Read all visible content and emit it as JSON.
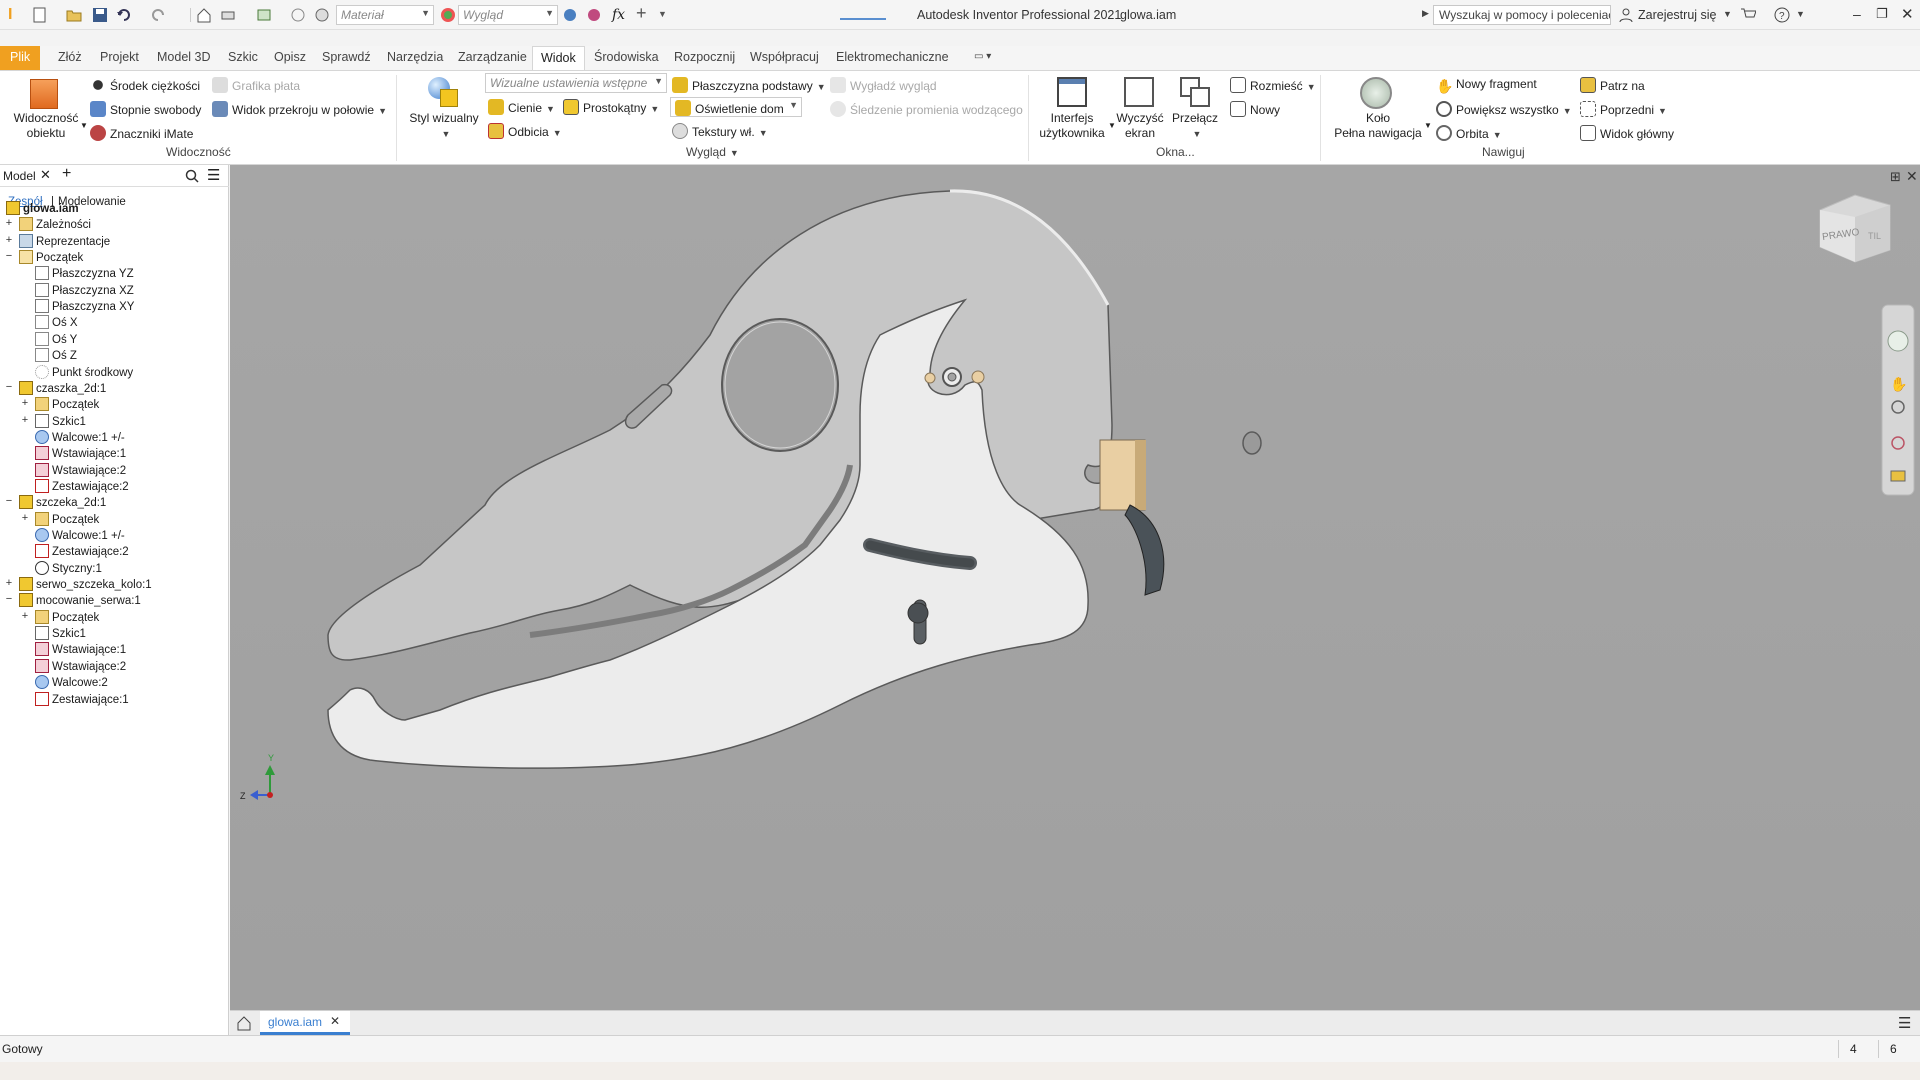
{
  "app": {
    "title": "Autodesk Inventor Professional 2021",
    "document": "glowa.iam"
  },
  "quick_access": {
    "material_placeholder": "Materiał",
    "appearance_placeholder": "Wygląd",
    "fx_label": "fx"
  },
  "search": {
    "placeholder": "Wyszukaj w pomocy i poleceniach"
  },
  "account": {
    "sign_in": "Zarejestruj się"
  },
  "menu": {
    "file": "Plik",
    "tabs": [
      "Złóż",
      "Projekt",
      "Model 3D",
      "Szkic",
      "Opisz",
      "Sprawdź",
      "Narzędzia",
      "Zarządzanie",
      "Widok",
      "Środowiska",
      "Rozpocznij",
      "Współpracuj",
      "Elektromechaniczne"
    ],
    "active": "Widok"
  },
  "ribbon": {
    "visibility": {
      "big_label_1": "Widoczność",
      "big_label_2": "obiektu",
      "center_of_gravity": "Środek ciężkości",
      "dof": "Stopnie swobody",
      "imate": "Znaczniki iMate",
      "plate_graphics": "Grafika płata",
      "half_section": "Widok przekroju w połowie",
      "group": "Widoczność"
    },
    "appearance": {
      "visual_style_1": "Styl wizualny",
      "preset_placeholder": "Wizualne ustawienia wstępne",
      "shadows": "Cienie",
      "reflections": "Odbicia",
      "orthographic": "Prostokątny",
      "ground_plane": "Płaszczyzna podstawy",
      "lighting": "Oświetlenie dom",
      "textures": "Tekstury wł.",
      "smooth_appearance": "Wygładź wygląd",
      "ray_tracing": "Śledzenie promienia wodzącego",
      "group": "Wygląd"
    },
    "windows": {
      "ui_1": "Interfejs",
      "ui_2": "użytkownika",
      "clear_1": "Wyczyść",
      "clear_2": "ekran",
      "switch": "Przełącz",
      "arrange": "Rozmieść",
      "new": "Nowy",
      "group": "Okna..."
    },
    "navigate": {
      "wheel_1": "Koło",
      "wheel_2": "Pełna nawigacja",
      "new_fragment": "Nowy fragment",
      "zoom_all": "Powiększ wszystko",
      "orbit": "Orbita",
      "look_at": "Patrz na",
      "previous": "Poprzedni",
      "home_view": "Widok główny",
      "group": "Nawiguj"
    }
  },
  "browser": {
    "tab": "Model",
    "subtab_1": "Zespół",
    "subtab_2": "Modelowanie",
    "tree": [
      {
        "label": "glowa.iam",
        "level": 0,
        "exp": "",
        "icon": "assembly"
      },
      {
        "label": "Zależności",
        "level": 1,
        "exp": "+",
        "icon": "folder"
      },
      {
        "label": "Reprezentacje",
        "level": 1,
        "exp": "+",
        "icon": "repr"
      },
      {
        "label": "Początek",
        "level": 1,
        "exp": "-",
        "icon": "folder-open"
      },
      {
        "label": "Płaszczyzna YZ",
        "level": 2,
        "exp": "",
        "icon": "plane"
      },
      {
        "label": "Płaszczyzna XZ",
        "level": 2,
        "exp": "",
        "icon": "plane"
      },
      {
        "label": "Płaszczyzna XY",
        "level": 2,
        "exp": "",
        "icon": "plane"
      },
      {
        "label": "Oś X",
        "level": 2,
        "exp": "",
        "icon": "axis"
      },
      {
        "label": "Oś Y",
        "level": 2,
        "exp": "",
        "icon": "axis"
      },
      {
        "label": "Oś Z",
        "level": 2,
        "exp": "",
        "icon": "axis"
      },
      {
        "label": "Punkt środkowy",
        "level": 2,
        "exp": "",
        "icon": "point"
      },
      {
        "label": "czaszka_2d:1",
        "level": 1,
        "exp": "-",
        "icon": "part-ground"
      },
      {
        "label": "Początek",
        "level": 2,
        "exp": "+",
        "icon": "folder"
      },
      {
        "label": "Szkic1",
        "level": 2,
        "exp": "+",
        "icon": "sketch"
      },
      {
        "label": "Walcowe:1 +/-",
        "level": 2,
        "exp": "",
        "icon": "joint-cyl"
      },
      {
        "label": "Wstawiające:1",
        "level": 2,
        "exp": "",
        "icon": "joint-ins"
      },
      {
        "label": "Wstawiające:2",
        "level": 2,
        "exp": "",
        "icon": "joint-ins"
      },
      {
        "label": "Zestawiające:2",
        "level": 2,
        "exp": "",
        "icon": "joint-mate"
      },
      {
        "label": "szczeka_2d:1",
        "level": 1,
        "exp": "-",
        "icon": "part"
      },
      {
        "label": "Początek",
        "level": 2,
        "exp": "+",
        "icon": "folder"
      },
      {
        "label": "Walcowe:1 +/-",
        "level": 2,
        "exp": "",
        "icon": "joint-cyl"
      },
      {
        "label": "Zestawiające:2",
        "level": 2,
        "exp": "",
        "icon": "joint-mate"
      },
      {
        "label": "Styczny:1",
        "level": 2,
        "exp": "",
        "icon": "tangent"
      },
      {
        "label": "serwo_szczeka_kolo:1",
        "level": 1,
        "exp": "+",
        "icon": "part"
      },
      {
        "label": "mocowanie_serwa:1",
        "level": 1,
        "exp": "-",
        "icon": "part"
      },
      {
        "label": "Początek",
        "level": 2,
        "exp": "+",
        "icon": "folder"
      },
      {
        "label": "Szkic1",
        "level": 2,
        "exp": "",
        "icon": "sketch"
      },
      {
        "label": "Wstawiające:1",
        "level": 2,
        "exp": "",
        "icon": "joint-ins"
      },
      {
        "label": "Wstawiające:2",
        "level": 2,
        "exp": "",
        "icon": "joint-ins"
      },
      {
        "label": "Walcowe:2",
        "level": 2,
        "exp": "",
        "icon": "joint-cyl"
      },
      {
        "label": "Zestawiające:1",
        "level": 2,
        "exp": "",
        "icon": "joint-mate"
      }
    ]
  },
  "viewcube": {
    "face": "PRAWO"
  },
  "triad": {
    "y": "Y",
    "z": "Z"
  },
  "doc_tab": {
    "label": "glowa.iam"
  },
  "status": {
    "text": "Gotowy",
    "num1": "4",
    "num2": "6"
  },
  "colors": {
    "accent": "#f0a020",
    "viewport": "#a3a3a3",
    "part_face": "#c9c9c9",
    "jaw_face": "#ececec"
  }
}
